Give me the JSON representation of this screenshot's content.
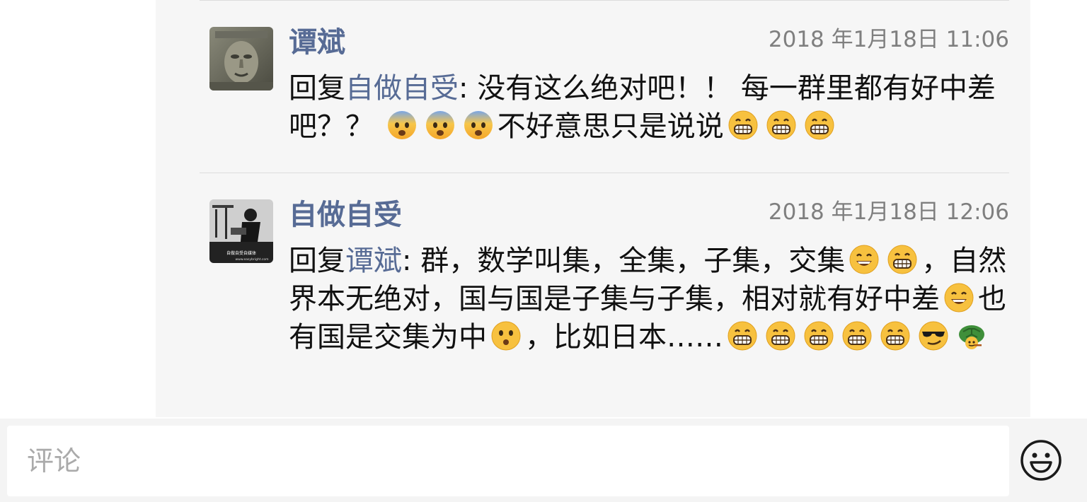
{
  "comments": [
    {
      "author": "谭斌",
      "time": "2018 年1月18日 11:06",
      "reply_prefix": "回复",
      "reply_to": "自做自受",
      "text_parts": [
        ": 没有这么绝对吧！！ 每一群里都有好中差吧？？ ",
        "不好意思只是说说"
      ]
    },
    {
      "author": "自做自受",
      "time": "2018 年1月18日 12:06",
      "reply_prefix": "回复",
      "reply_to": "谭斌",
      "text_parts": [
        ": 群，数学叫集，全集，子集，交集",
        "，自然界本无绝对，国与国是子集与子集，相对就有好中差",
        "也有国是交集为中",
        "，比如日本……"
      ],
      "avatar_caption": "自做自受自媒体",
      "avatar_url_text": "www.easybright.com"
    }
  ],
  "input": {
    "placeholder": "评论"
  },
  "icons": {
    "emoji_button": "smiley-face-icon"
  },
  "colors": {
    "link": "#576b95",
    "panel_bg": "#f6f6f6",
    "time": "#7f7f7f"
  }
}
